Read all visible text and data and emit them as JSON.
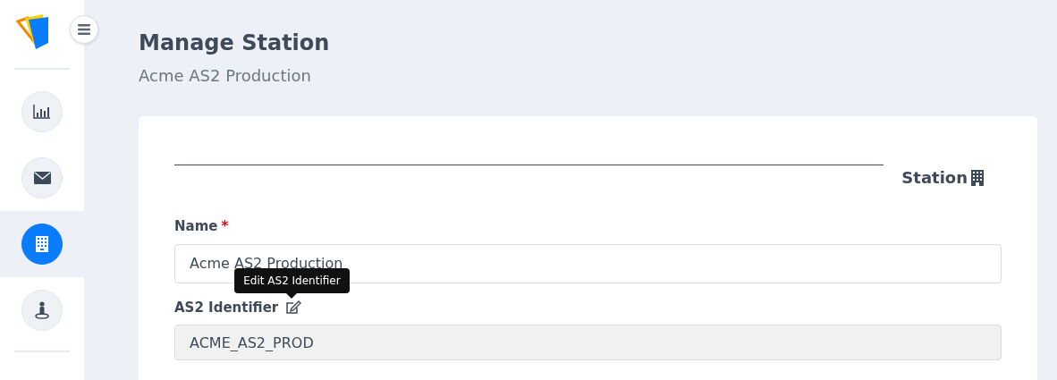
{
  "sidebar": {
    "items": [
      {
        "kind": "chart",
        "selected": false
      },
      {
        "kind": "mail",
        "selected": false
      },
      {
        "kind": "building",
        "selected": true
      },
      {
        "kind": "person",
        "selected": false
      }
    ]
  },
  "page": {
    "title": "Manage Station",
    "subtitle": "Acme AS2 Production"
  },
  "section": {
    "title": "Station"
  },
  "fields": [
    {
      "label": "Name",
      "required_mark": "*",
      "value": "Acme AS2 Production",
      "readonly": false,
      "editable_icon": false
    },
    {
      "label": "AS2 Identifier",
      "value": "ACME_AS2_PROD",
      "readonly": true,
      "editable_icon": true,
      "tooltip": "Edit AS2 Identifier"
    }
  ]
}
